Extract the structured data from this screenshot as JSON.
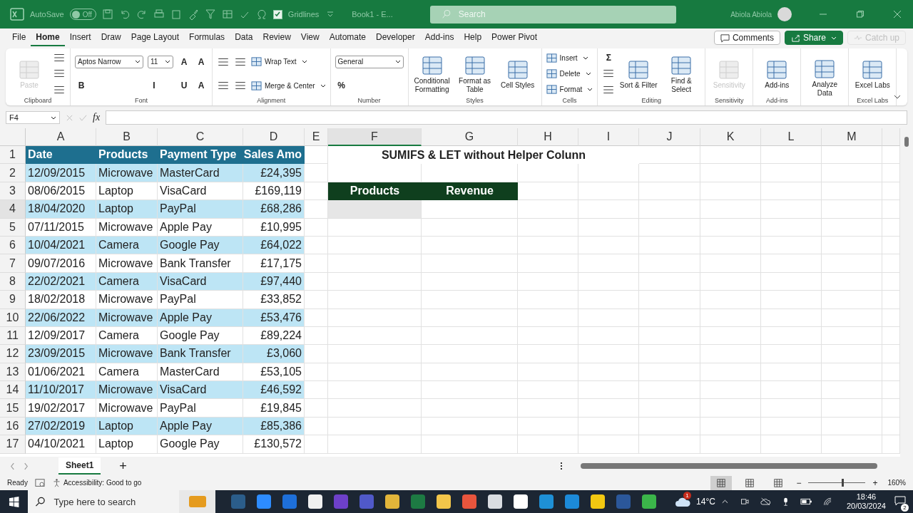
{
  "title_bar": {
    "autosave_label": "AutoSave",
    "autosave": {
      "on": false,
      "label": "Off"
    },
    "gridlines": {
      "label": "Gridlines",
      "checked": true
    },
    "document_title": "Book1  -  E...",
    "search": {
      "placeholder": "Search"
    },
    "user_name": "Abiola Abiola"
  },
  "menu_tabs": [
    {
      "label": "File",
      "selected": false
    },
    {
      "label": "Home",
      "selected": true
    },
    {
      "label": "Insert",
      "selected": false
    },
    {
      "label": "Draw",
      "selected": false
    },
    {
      "label": "Page Layout",
      "selected": false
    },
    {
      "label": "Formulas",
      "selected": false
    },
    {
      "label": "Data",
      "selected": false
    },
    {
      "label": "Review",
      "selected": false
    },
    {
      "label": "View",
      "selected": false
    },
    {
      "label": "Automate",
      "selected": false
    },
    {
      "label": "Developer",
      "selected": false
    },
    {
      "label": "Add-ins",
      "selected": false
    },
    {
      "label": "Help",
      "selected": false
    },
    {
      "label": "Power Pivot",
      "selected": false
    }
  ],
  "menu_actions": {
    "comments": "Comments",
    "share": "Share",
    "catch_up": {
      "label": "Catch up",
      "disabled": true
    }
  },
  "ribbon": [
    {
      "label": "Clipboard",
      "columns": [
        [
          {
            "kind": "large",
            "label": "Paste",
            "disabled": true
          }
        ],
        [
          {
            "kind": "icon",
            "disabled": false
          },
          {
            "kind": "icon",
            "disabled": false
          },
          {
            "kind": "icon",
            "disabled": false
          }
        ]
      ]
    },
    {
      "label": "Font",
      "columns": [
        [
          {
            "kind": "select",
            "label": "Aptos Narrow",
            "disabled": false
          },
          {
            "kind": "glyph",
            "label": "B",
            "disabled": false
          }
        ],
        [
          {
            "kind": "select",
            "label": "11",
            "disabled": false
          },
          {
            "kind": "glyph",
            "label": "I",
            "disabled": false
          }
        ],
        [
          {
            "kind": "glyph",
            "label": "A",
            "disabled": false
          },
          {
            "kind": "glyph",
            "label": "U",
            "disabled": false
          }
        ],
        [
          {
            "kind": "glyph",
            "label": "A",
            "disabled": false
          },
          {
            "kind": "glyph",
            "label": "A",
            "disabled": false
          }
        ]
      ]
    },
    {
      "label": "Alignment",
      "columns": [
        [
          {
            "kind": "icon",
            "disabled": false
          },
          {
            "kind": "icon",
            "disabled": false
          }
        ],
        [
          {
            "kind": "icon",
            "disabled": false
          },
          {
            "kind": "icon",
            "disabled": false
          }
        ],
        [
          {
            "kind": "small",
            "label": "Wrap Text",
            "disabled": false
          },
          {
            "kind": "small",
            "label": "Merge & Center",
            "disabled": false
          }
        ]
      ]
    },
    {
      "label": "Number",
      "columns": [
        [
          {
            "kind": "select",
            "label": "General",
            "disabled": false
          },
          {
            "kind": "glyph",
            "label": "%",
            "disabled": false
          }
        ]
      ]
    },
    {
      "label": "Styles",
      "columns": [
        [
          {
            "kind": "large",
            "label": "Conditional Formatting",
            "disabled": false
          }
        ],
        [
          {
            "kind": "large",
            "label": "Format as Table",
            "disabled": false
          }
        ],
        [
          {
            "kind": "large",
            "label": "Cell Styles",
            "disabled": false
          }
        ]
      ]
    },
    {
      "label": "Cells",
      "columns": [
        [
          {
            "kind": "small",
            "label": "Insert",
            "disabled": false
          },
          {
            "kind": "small",
            "label": "Delete",
            "disabled": false
          },
          {
            "kind": "small",
            "label": "Format",
            "disabled": false
          }
        ]
      ]
    },
    {
      "label": "Editing",
      "columns": [
        [
          {
            "kind": "glyph",
            "label": "Σ",
            "disabled": false
          },
          {
            "kind": "icon",
            "disabled": false
          },
          {
            "kind": "icon",
            "disabled": false
          }
        ],
        [
          {
            "kind": "large",
            "label": "Sort & Filter",
            "disabled": false
          }
        ],
        [
          {
            "kind": "large",
            "label": "Find & Select",
            "disabled": false
          }
        ]
      ]
    },
    {
      "label": "Sensitivity",
      "columns": [
        [
          {
            "kind": "large",
            "label": "Sensitivity",
            "disabled": true
          }
        ]
      ]
    },
    {
      "label": "Add-ins",
      "columns": [
        [
          {
            "kind": "large",
            "label": "Add-ins",
            "disabled": false
          }
        ]
      ]
    },
    {
      "columns": [
        [
          {
            "kind": "large",
            "label": "Analyze Data",
            "disabled": false
          }
        ]
      ]
    },
    {
      "label": "Excel Labs",
      "columns": [
        [
          {
            "kind": "large",
            "label": "Excel Labs",
            "disabled": false
          }
        ]
      ]
    }
  ],
  "formula_bar": {
    "name_box": "F4",
    "function_label": "fx"
  },
  "sheet": {
    "columns": [
      {
        "label": "A",
        "selected": false
      },
      {
        "label": "B",
        "selected": false
      },
      {
        "label": "C",
        "selected": false
      },
      {
        "label": "D",
        "selected": false
      },
      {
        "label": "E",
        "selected": false
      },
      {
        "label": "F",
        "selected": true
      },
      {
        "label": "G",
        "selected": false
      },
      {
        "label": "H",
        "selected": false
      },
      {
        "label": "I",
        "selected": false
      },
      {
        "label": "J",
        "selected": false
      },
      {
        "label": "K",
        "selected": false
      },
      {
        "label": "L",
        "selected": false
      },
      {
        "label": "M",
        "selected": false
      }
    ],
    "title": "SUMIFS & LET without Helper Colunn",
    "summary_headers": [
      "Products",
      "Revenue"
    ],
    "rows": [
      {
        "number": "1",
        "kind": "header",
        "selected": false,
        "cells": [
          "Date",
          "Products",
          "Payment Type",
          "Sales Amo"
        ]
      },
      {
        "number": "2",
        "kind": "shaded",
        "selected": false,
        "cells": [
          "12/09/2015",
          "Microwave",
          "MasterCard",
          "£24,395"
        ]
      },
      {
        "number": "3",
        "kind": "plain",
        "selected": false,
        "cells": [
          "08/06/2015",
          "Laptop",
          "VisaCard",
          "£169,119"
        ]
      },
      {
        "number": "4",
        "kind": "shaded",
        "selected": true,
        "cells": [
          "18/04/2020",
          "Laptop",
          "PayPal",
          "£68,286"
        ]
      },
      {
        "number": "5",
        "kind": "plain",
        "selected": false,
        "cells": [
          "07/11/2015",
          "Microwave",
          "Apple Pay",
          "£10,995"
        ]
      },
      {
        "number": "6",
        "kind": "shaded",
        "selected": false,
        "cells": [
          "10/04/2021",
          "Camera",
          "Google Pay",
          "£64,022"
        ]
      },
      {
        "number": "7",
        "kind": "plain",
        "selected": false,
        "cells": [
          "09/07/2016",
          "Microwave",
          "Bank Transfer",
          "£17,175"
        ]
      },
      {
        "number": "8",
        "kind": "shaded",
        "selected": false,
        "cells": [
          "22/02/2021",
          "Camera",
          "VisaCard",
          "£97,440"
        ]
      },
      {
        "number": "9",
        "kind": "plain",
        "selected": false,
        "cells": [
          "18/02/2018",
          "Microwave",
          "PayPal",
          "£33,852"
        ]
      },
      {
        "number": "10",
        "kind": "shaded",
        "selected": false,
        "cells": [
          "22/06/2022",
          "Microwave",
          "Apple Pay",
          "£53,476"
        ]
      },
      {
        "number": "11",
        "kind": "plain",
        "selected": false,
        "cells": [
          "12/09/2017",
          "Camera",
          "Google Pay",
          "£89,224"
        ]
      },
      {
        "number": "12",
        "kind": "shaded",
        "selected": false,
        "cells": [
          "23/09/2015",
          "Microwave",
          "Bank Transfer",
          "£3,060"
        ]
      },
      {
        "number": "13",
        "kind": "plain",
        "selected": false,
        "cells": [
          "01/06/2021",
          "Camera",
          "MasterCard",
          "£53,105"
        ]
      },
      {
        "number": "14",
        "kind": "shaded",
        "selected": false,
        "cells": [
          "11/10/2017",
          "Microwave",
          "VisaCard",
          "£46,592"
        ]
      },
      {
        "number": "15",
        "kind": "plain",
        "selected": false,
        "cells": [
          "19/02/2017",
          "Microwave",
          "PayPal",
          "£19,845"
        ]
      },
      {
        "number": "16",
        "kind": "shaded",
        "selected": false,
        "cells": [
          "27/02/2019",
          "Laptop",
          "Apple Pay",
          "£85,386"
        ]
      },
      {
        "number": "17",
        "kind": "plain",
        "selected": false,
        "cells": [
          "04/10/2021",
          "Laptop",
          "Google Pay",
          "£130,572"
        ]
      }
    ]
  },
  "sheet_tabs": [
    {
      "label": "Sheet1",
      "selected": true
    }
  ],
  "add_sheet": "+",
  "status_bar": {
    "ready": "Ready",
    "accessibility": "Accessibility: Good to go",
    "views": [
      {
        "selected": true
      },
      {
        "selected": false
      },
      {
        "selected": false
      }
    ],
    "zoom": {
      "level": 0.6,
      "reading": "160%",
      "minus": "−",
      "plus": "+"
    }
  },
  "taskbar": {
    "search_placeholder": "Type here to search",
    "weather": {
      "badge": "1",
      "temperature": "14°C"
    },
    "time": "18:46",
    "date": "20/03/2024",
    "notifications": "2"
  }
}
